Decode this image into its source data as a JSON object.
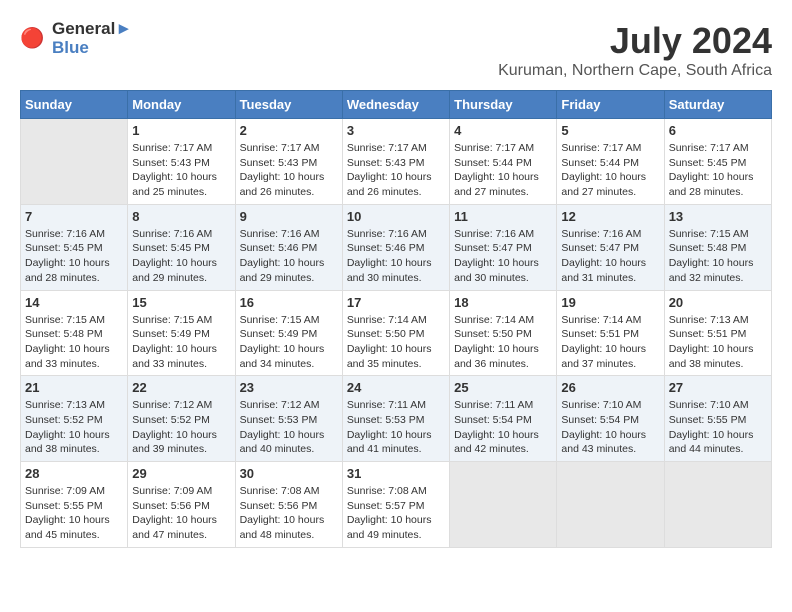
{
  "header": {
    "logo_line1": "General",
    "logo_line2": "Blue",
    "title": "July 2024",
    "location": "Kuruman, Northern Cape, South Africa"
  },
  "days_of_week": [
    "Sunday",
    "Monday",
    "Tuesday",
    "Wednesday",
    "Thursday",
    "Friday",
    "Saturday"
  ],
  "weeks": [
    [
      {
        "day": "",
        "info": ""
      },
      {
        "day": "1",
        "info": "Sunrise: 7:17 AM\nSunset: 5:43 PM\nDaylight: 10 hours\nand 25 minutes."
      },
      {
        "day": "2",
        "info": "Sunrise: 7:17 AM\nSunset: 5:43 PM\nDaylight: 10 hours\nand 26 minutes."
      },
      {
        "day": "3",
        "info": "Sunrise: 7:17 AM\nSunset: 5:43 PM\nDaylight: 10 hours\nand 26 minutes."
      },
      {
        "day": "4",
        "info": "Sunrise: 7:17 AM\nSunset: 5:44 PM\nDaylight: 10 hours\nand 27 minutes."
      },
      {
        "day": "5",
        "info": "Sunrise: 7:17 AM\nSunset: 5:44 PM\nDaylight: 10 hours\nand 27 minutes."
      },
      {
        "day": "6",
        "info": "Sunrise: 7:17 AM\nSunset: 5:45 PM\nDaylight: 10 hours\nand 28 minutes."
      }
    ],
    [
      {
        "day": "7",
        "info": "Sunrise: 7:16 AM\nSunset: 5:45 PM\nDaylight: 10 hours\nand 28 minutes."
      },
      {
        "day": "8",
        "info": "Sunrise: 7:16 AM\nSunset: 5:45 PM\nDaylight: 10 hours\nand 29 minutes."
      },
      {
        "day": "9",
        "info": "Sunrise: 7:16 AM\nSunset: 5:46 PM\nDaylight: 10 hours\nand 29 minutes."
      },
      {
        "day": "10",
        "info": "Sunrise: 7:16 AM\nSunset: 5:46 PM\nDaylight: 10 hours\nand 30 minutes."
      },
      {
        "day": "11",
        "info": "Sunrise: 7:16 AM\nSunset: 5:47 PM\nDaylight: 10 hours\nand 30 minutes."
      },
      {
        "day": "12",
        "info": "Sunrise: 7:16 AM\nSunset: 5:47 PM\nDaylight: 10 hours\nand 31 minutes."
      },
      {
        "day": "13",
        "info": "Sunrise: 7:15 AM\nSunset: 5:48 PM\nDaylight: 10 hours\nand 32 minutes."
      }
    ],
    [
      {
        "day": "14",
        "info": "Sunrise: 7:15 AM\nSunset: 5:48 PM\nDaylight: 10 hours\nand 33 minutes."
      },
      {
        "day": "15",
        "info": "Sunrise: 7:15 AM\nSunset: 5:49 PM\nDaylight: 10 hours\nand 33 minutes."
      },
      {
        "day": "16",
        "info": "Sunrise: 7:15 AM\nSunset: 5:49 PM\nDaylight: 10 hours\nand 34 minutes."
      },
      {
        "day": "17",
        "info": "Sunrise: 7:14 AM\nSunset: 5:50 PM\nDaylight: 10 hours\nand 35 minutes."
      },
      {
        "day": "18",
        "info": "Sunrise: 7:14 AM\nSunset: 5:50 PM\nDaylight: 10 hours\nand 36 minutes."
      },
      {
        "day": "19",
        "info": "Sunrise: 7:14 AM\nSunset: 5:51 PM\nDaylight: 10 hours\nand 37 minutes."
      },
      {
        "day": "20",
        "info": "Sunrise: 7:13 AM\nSunset: 5:51 PM\nDaylight: 10 hours\nand 38 minutes."
      }
    ],
    [
      {
        "day": "21",
        "info": "Sunrise: 7:13 AM\nSunset: 5:52 PM\nDaylight: 10 hours\nand 38 minutes."
      },
      {
        "day": "22",
        "info": "Sunrise: 7:12 AM\nSunset: 5:52 PM\nDaylight: 10 hours\nand 39 minutes."
      },
      {
        "day": "23",
        "info": "Sunrise: 7:12 AM\nSunset: 5:53 PM\nDaylight: 10 hours\nand 40 minutes."
      },
      {
        "day": "24",
        "info": "Sunrise: 7:11 AM\nSunset: 5:53 PM\nDaylight: 10 hours\nand 41 minutes."
      },
      {
        "day": "25",
        "info": "Sunrise: 7:11 AM\nSunset: 5:54 PM\nDaylight: 10 hours\nand 42 minutes."
      },
      {
        "day": "26",
        "info": "Sunrise: 7:10 AM\nSunset: 5:54 PM\nDaylight: 10 hours\nand 43 minutes."
      },
      {
        "day": "27",
        "info": "Sunrise: 7:10 AM\nSunset: 5:55 PM\nDaylight: 10 hours\nand 44 minutes."
      }
    ],
    [
      {
        "day": "28",
        "info": "Sunrise: 7:09 AM\nSunset: 5:55 PM\nDaylight: 10 hours\nand 45 minutes."
      },
      {
        "day": "29",
        "info": "Sunrise: 7:09 AM\nSunset: 5:56 PM\nDaylight: 10 hours\nand 47 minutes."
      },
      {
        "day": "30",
        "info": "Sunrise: 7:08 AM\nSunset: 5:56 PM\nDaylight: 10 hours\nand 48 minutes."
      },
      {
        "day": "31",
        "info": "Sunrise: 7:08 AM\nSunset: 5:57 PM\nDaylight: 10 hours\nand 49 minutes."
      },
      {
        "day": "",
        "info": ""
      },
      {
        "day": "",
        "info": ""
      },
      {
        "day": "",
        "info": ""
      }
    ]
  ]
}
